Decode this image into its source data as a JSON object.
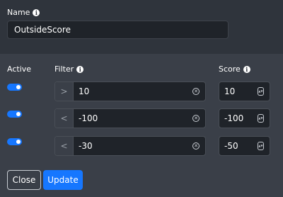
{
  "form": {
    "name_label": "Name",
    "name_value": "OutsideScore",
    "columns": {
      "active": "Active",
      "filter": "Filter",
      "score": "Score"
    },
    "rows": [
      {
        "active": true,
        "operator": ">",
        "filter": "10",
        "score": "10"
      },
      {
        "active": true,
        "operator": "<",
        "filter": "-100",
        "score": "-100"
      },
      {
        "active": true,
        "operator": "<",
        "filter": "-30",
        "score": "-50"
      }
    ]
  },
  "actions": {
    "close_label": "Close",
    "update_label": "Update"
  },
  "icons": {
    "info": "info-icon",
    "clear": "clear-circle-x-icon",
    "spinner": "number-spinner-icon"
  },
  "colors": {
    "accent": "#1677ff",
    "panel_top": "#2f343c",
    "panel": "#3a3f48",
    "input_bg": "#1f2329"
  }
}
